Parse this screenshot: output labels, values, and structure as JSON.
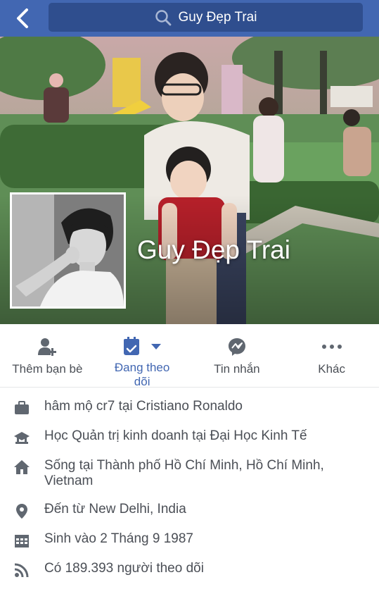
{
  "header": {
    "search_text": "Guy Đẹp Trai"
  },
  "profile": {
    "name": "Guy Đẹp Trai"
  },
  "actions": [
    {
      "label": "Thêm bạn bè",
      "icon": "add-friend-icon"
    },
    {
      "label": "Đang theo dõi",
      "icon": "following-icon"
    },
    {
      "label": "Tin nhắn",
      "icon": "messenger-icon"
    },
    {
      "label": "Khác",
      "icon": "more-icon"
    }
  ],
  "about": [
    {
      "icon": "briefcase-icon",
      "text": "hâm mộ cr7 tại Cristiano Ronaldo"
    },
    {
      "icon": "graduation-cap-icon",
      "text": "Học Quản trị kinh doanh tại Đại Học Kinh Tế"
    },
    {
      "icon": "home-icon",
      "text": "Sống tại Thành phố Hồ Chí Minh, Hồ Chí Minh, Vietnam"
    },
    {
      "icon": "location-pin-icon",
      "text": "Đến từ New Delhi, India"
    },
    {
      "icon": "calendar-icon",
      "text": "Sinh vào 2 Tháng 9 1987"
    },
    {
      "icon": "rss-icon",
      "text": "Có 189.393 người theo dõi"
    }
  ],
  "colors": {
    "brand": "#4267b2",
    "search_bg": "#2f4e8e",
    "text_secondary": "#4b4f56"
  }
}
